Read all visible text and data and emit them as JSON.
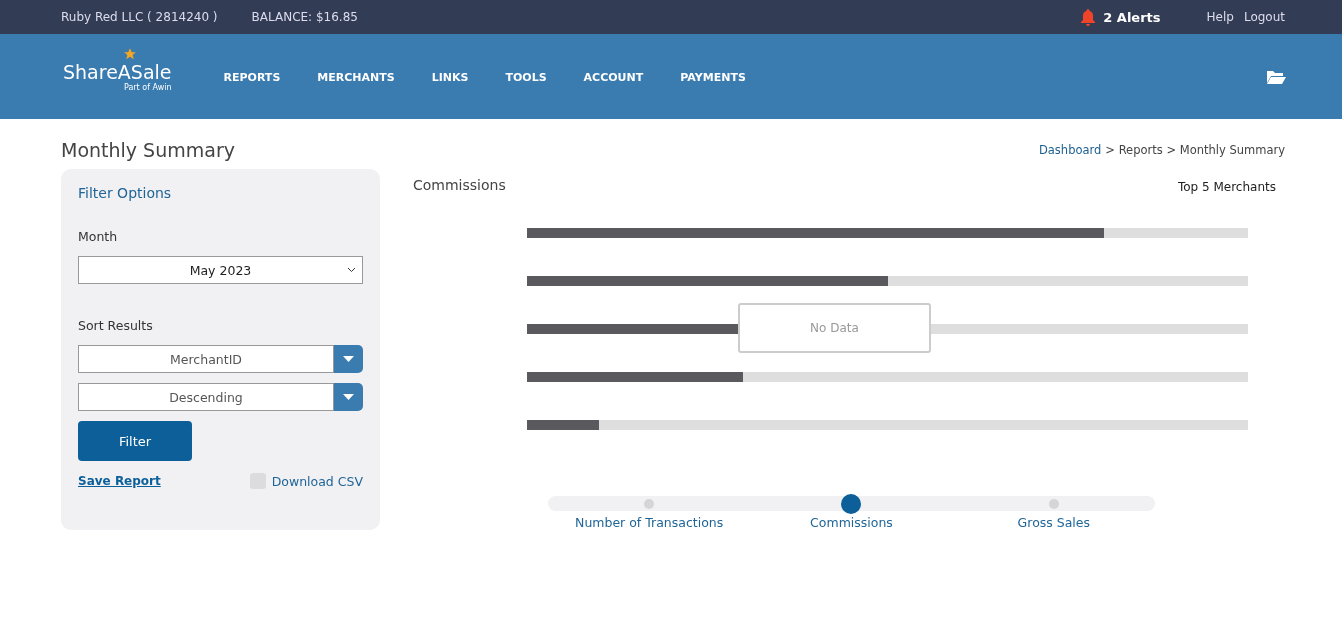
{
  "top_bar": {
    "account": "Ruby Red LLC ( 2814240 )",
    "balance": "BALANCE: $16.85",
    "alerts": "2 Alerts",
    "links": [
      "Help",
      "Logout"
    ]
  },
  "header": {
    "logo": "ShareASale",
    "logo_sub": "Part of Awin",
    "nav": [
      "REPORTS",
      "MERCHANTS",
      "LINKS",
      "TOOLS",
      "ACCOUNT",
      "PAYMENTS"
    ]
  },
  "page_title": "Monthly Summary",
  "breadcrumb": {
    "links": [
      "Dashboard"
    ],
    "rest": "> Reports > Monthly Summary"
  },
  "filter": {
    "title": "Filter Options",
    "month_label": "Month",
    "month": "May 2023",
    "sort_label": "Sort Results",
    "sort_by": "MerchantID",
    "order": "Descending",
    "button": "Filter",
    "save": "Save Report",
    "csv": {
      "label": "Download CSV",
      "checked": false
    }
  },
  "chart": {
    "title": "Commissions",
    "subtitle": "Top 5 Merchants",
    "no_data": "No Data",
    "bars": [
      {
        "level": 0.8
      },
      {
        "level": 0.5
      },
      {
        "level": 0.3
      },
      {
        "level": 0.3
      },
      {
        "level": 0.1
      }
    ]
  },
  "metrics": [
    {
      "label": "Number of Transactions",
      "selected": false
    },
    {
      "label": "Commissions",
      "selected": true
    },
    {
      "label": "Gross Sales",
      "selected": false
    }
  ]
}
